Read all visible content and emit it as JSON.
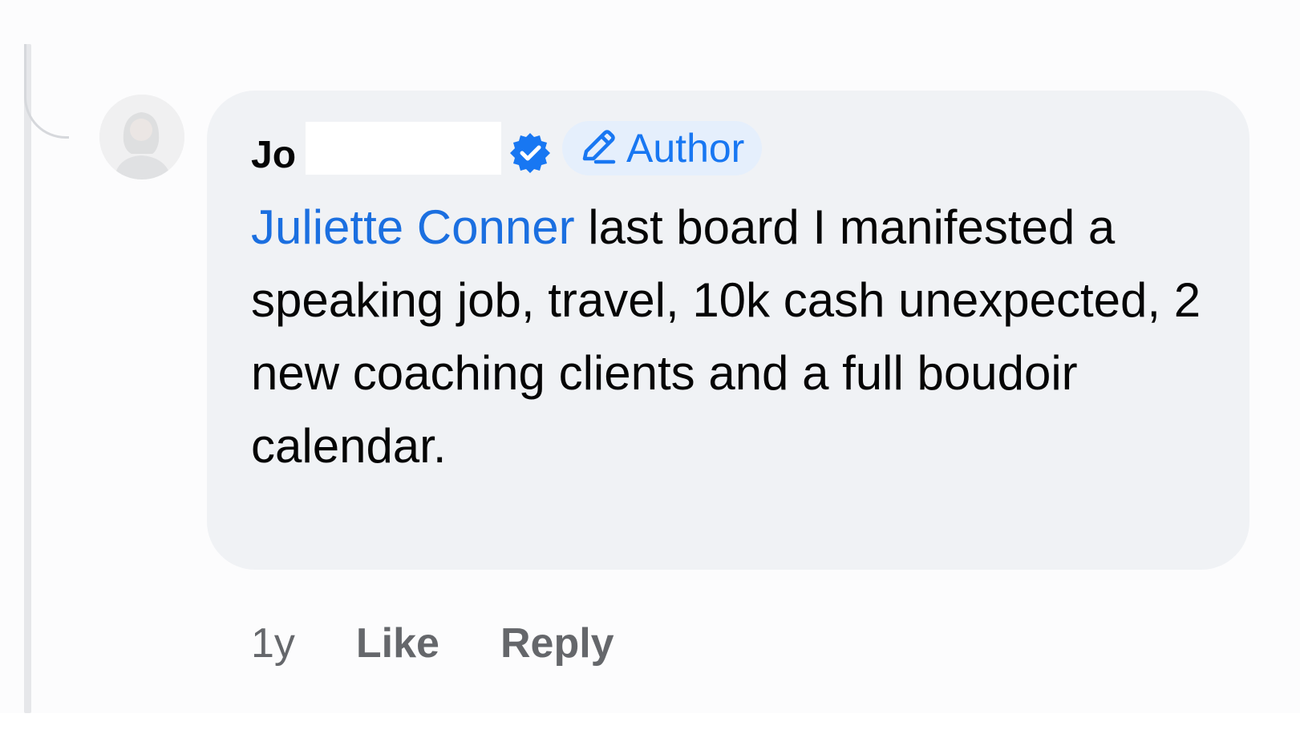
{
  "comment": {
    "author_visible": "Jo",
    "verified_icon": "verified-check-icon",
    "badge": {
      "icon": "pencil-icon",
      "label": "Author"
    },
    "mention": "Juliette Conner",
    "text": " last board I manifested a speaking job, travel, 10k cash unexpected, 2 new coaching clients and a full boudoir calendar."
  },
  "actions": {
    "timestamp": "1y",
    "like_label": "Like",
    "reply_label": "Reply"
  },
  "colors": {
    "bubble": "#f0f2f5",
    "accent": "#1877f2",
    "mention": "#1b6fe0",
    "badge_bg": "#e5effc",
    "secondary_text": "#65676b"
  }
}
